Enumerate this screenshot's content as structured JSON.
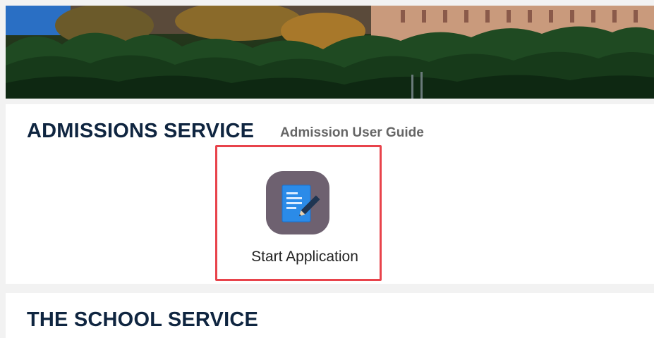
{
  "admissions": {
    "title": "ADMISSIONS SERVICE",
    "guide_link": "Admission User Guide",
    "tile": {
      "label": "Start Application",
      "icon": "document-edit-icon",
      "icon_bg_color": "#6e6170"
    }
  },
  "school": {
    "title": "THE SCHOOL SERVICE"
  },
  "colors": {
    "heading": "#0f2540",
    "highlight_border": "#e8434b"
  }
}
